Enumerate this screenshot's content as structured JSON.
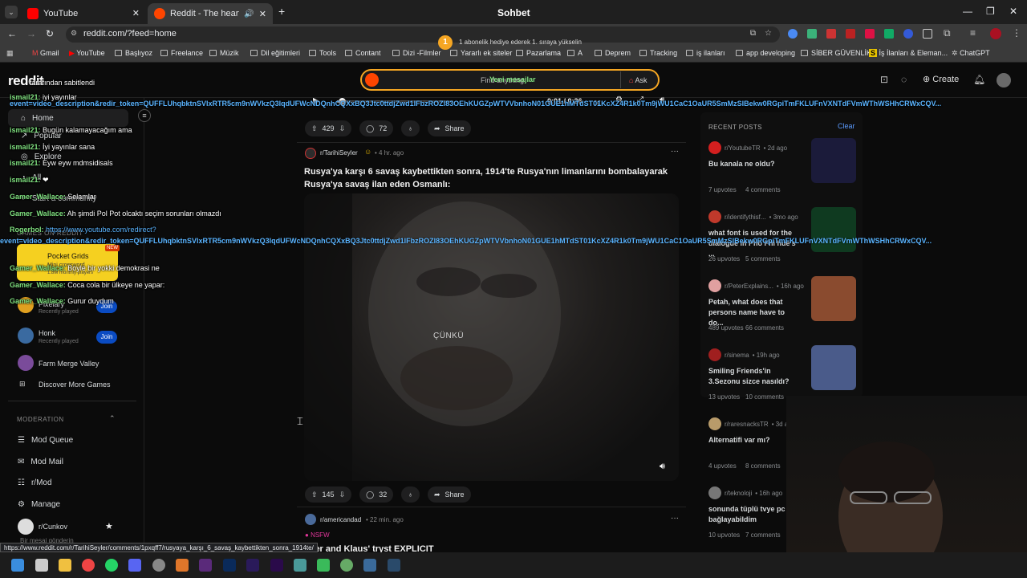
{
  "browser": {
    "tabs": [
      {
        "label": "YouTube",
        "active": false
      },
      {
        "label": "Reddit - The heart of the in",
        "active": true
      }
    ],
    "window_title": "Sohbet",
    "url": "reddit.com/?feed=home",
    "bookmarks": [
      "Gmail",
      "YouTube",
      "Başlıyoz",
      "Freelance",
      "Müzik",
      "Dil eğitimleri",
      "Tools",
      "Contant",
      "Dizi -Filmler",
      "Yararlı ek siteler",
      "Pazarlama",
      "A",
      "Deprem",
      "Tracking",
      "iş ilanları",
      "app developing",
      "SİBER GÜVENLİK",
      "İş İlanları & Eleman...",
      "ChatGPT"
    ]
  },
  "overlay": {
    "subscription_badge_count": "1",
    "subscription_text": "1 abonelik hediye ederek 1. sıraya yükselin",
    "new_messages": "Yeni mesajlar",
    "chat_lines": [
      {
        "user": "",
        "text": "tarafından sabitlendi"
      },
      {
        "user": "",
        "text": "Bugün kalamayacağım ama"
      },
      {
        "user": "ismail21:",
        "text": "İyi yayınlar sana"
      },
      {
        "user": "ismail21:",
        "text": "Eyw eyw mdmsidisals"
      },
      {
        "user": "ismail21:",
        "text": "❤"
      },
      {
        "user": "Gamer_Wallace:",
        "text": "Selamlar"
      },
      {
        "user": "Gamer_Wallace:",
        "text": "Ah şimdi Pol Pot olcaktı seçim sorunları olmazdı"
      },
      {
        "user": "Rogerbol:",
        "text": "https://www.youtube.com/redirect?"
      },
      {
        "user": "Gamer_Wallace:",
        "text": "Coca cola bir ülkeye ne yapar:"
      },
      {
        "user": "Gamer_Wallace:",
        "text": "Gurur duydum"
      },
      {
        "user": "Gamer_Wallace:",
        "text": "Boyle bir yokki demokrasi ne"
      },
      {
        "user": "ismail21:",
        "text": "iyi yayınlar"
      }
    ],
    "redirect_text": "event=video_description&redir_token=QUFFLUhqbktnSVlxRTR5cm9nWVkzQ3lqdUFWcNDQnhCQXxBQ3Jtc0ttdjZwd1lFbzROZl83OEhKUGZpWTVVbnhoN01GUE1hMTdST01KcXZ4R1k0Tm9jWU1CaC1OaUR5SmMzSlBekw0RGpiTmFKLUFnVXNTdFVmWThWSHhCRWxCQV...",
    "send_message": "Bir mesaj gönderin",
    "chat_input_placeholder": "Bir mesaj gönderin"
  },
  "header": {
    "logo": "reddit",
    "search_placeholder": "Find anything",
    "ask_label": "Ask",
    "create_label": "Create"
  },
  "sidebar": {
    "items": [
      {
        "label": "Home",
        "icon": "home-icon"
      },
      {
        "label": "Popular",
        "icon": "popular-icon"
      },
      {
        "label": "Explore",
        "icon": "explore-icon"
      },
      {
        "label": "All",
        "icon": "all-icon"
      },
      {
        "label": "Start a community",
        "icon": "plus-icon"
      }
    ],
    "games_header": "GAMES ON REDDIT",
    "featured_game": {
      "name": "Pocket Grids",
      "desc": "Mini crossword",
      "players": "1.8M monthly players",
      "badge": "NEW"
    },
    "games": [
      {
        "name": "Pixelary",
        "sub": "Recently played",
        "join": "Join"
      },
      {
        "name": "Honk",
        "sub": "Recently played",
        "join": "Join"
      },
      {
        "name": "Farm Merge Valley",
        "sub": "",
        "join": ""
      }
    ],
    "discover": "Discover More Games",
    "moderation_header": "MODERATION",
    "mod_items": [
      "Mod Queue",
      "Mod Mail",
      "r/Mod",
      "Manage"
    ],
    "community": "r/Cunkov"
  },
  "player": {
    "time": "0:01 / 0:26",
    "progress": 0.04
  },
  "post1": {
    "upvotes": "429",
    "comments": "72",
    "share": "Share"
  },
  "post2": {
    "subreddit": "r/TarihiSeyler",
    "age": "• 4 hr. ago",
    "title": "Rusya'ya karşı 6 savaş kaybettikten sonra, 1914'te Rusya'nın limanlarını bombalayarak Rusya'ya savaş ilan eden Osmanlı:",
    "caption": "ÇÜNKÜ",
    "upvotes": "145",
    "comments": "32",
    "share": "Share"
  },
  "post3": {
    "subreddit": "r/americandad",
    "age": "• 22 min. ago",
    "nsfw": "NSFW",
    "title": "oger and Klaus' tryst EXPLICIT"
  },
  "recent": {
    "header": "RECENT POSTS",
    "clear": "Clear",
    "posts": [
      {
        "sub": "r/YoutubeTR",
        "age": "• 2d ago",
        "title": "Bu kanala ne oldu?",
        "upvotes": "7 upvotes",
        "comments": "4 comments",
        "color": "#d31f1f",
        "thumb": "#1b1b3a"
      },
      {
        "sub": "r/identifythisf...",
        "age": "• 3mo ago",
        "title": "what font is used for the dialogue in Pho Fhi hue's ...",
        "upvotes": "26 upvotes",
        "comments": "5 comments",
        "color": "#c0392b",
        "thumb": "#0f3a20"
      },
      {
        "sub": "r/PeterExplains...",
        "age": "• 16h ago",
        "title": "Petah, what does that persons name have to do...",
        "upvotes": "489 upvotes",
        "comments": "66 comments",
        "color": "#e0a0a0",
        "thumb": "#8a4b2f"
      },
      {
        "sub": "r/sinema",
        "age": "• 19h ago",
        "title": "Smiling Friends'in 3.Sezonu sizce nasıldı?",
        "upvotes": "13 upvotes",
        "comments": "10 comments",
        "color": "#a01f1f",
        "thumb": "#4a5b8a"
      },
      {
        "sub": "r/raresnacksTR",
        "age": "• 3d a",
        "title": "Alternatifi var mı?",
        "upvotes": "4 upvotes",
        "comments": "8 comments",
        "color": "#b89b6a",
        "thumb": ""
      },
      {
        "sub": "r/teknoloji",
        "age": "• 16h ago",
        "title": "sonunda tüplü tvye pc bağlayabildim",
        "upvotes": "10 upvotes",
        "comments": "7 comments",
        "color": "#777",
        "thumb": ""
      }
    ]
  },
  "status_url": "https://www.reddit.com/r/TarihiSeyler/comments/1pxqff7/rusyaya_karşı_6_savaş_kaybettikten_sonra_1914te/"
}
